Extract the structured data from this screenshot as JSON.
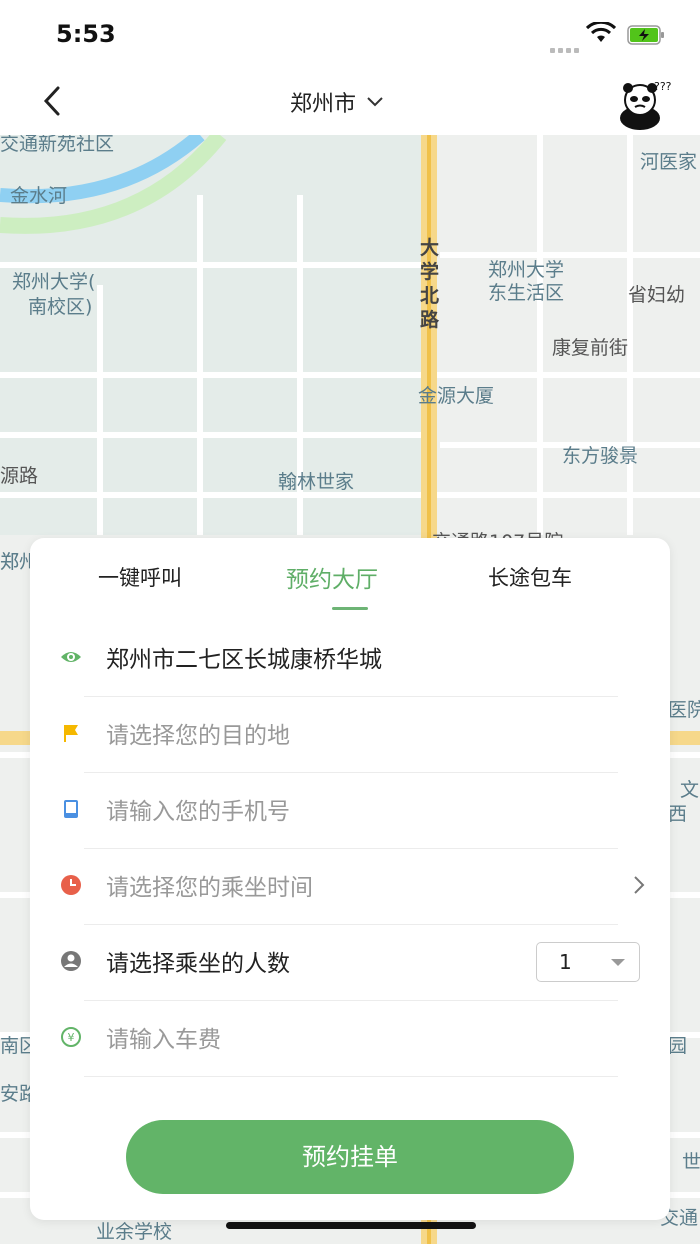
{
  "status_bar": {
    "time": "5:53"
  },
  "header": {
    "city": "郑州市"
  },
  "map": {
    "labels": [
      "交通新苑社区",
      "金水河",
      "郑州大学(",
      "南校区)",
      "大",
      "学",
      "北",
      "路",
      "郑州大学",
      "东生活区",
      "康复前街",
      "省妇幼",
      "金源大厦",
      "东方骏景",
      "翰林世家",
      "源路",
      "河医家",
      "郑州",
      "交通路107号院",
      "医院",
      "文",
      "西",
      "南区",
      "安路",
      "园",
      "业余学校",
      "世",
      "交通",
      "郑"
    ]
  },
  "tabs": [
    {
      "label": "一键呼叫",
      "active": false
    },
    {
      "label": "预约大厅",
      "active": true
    },
    {
      "label": "长途包车",
      "active": false
    }
  ],
  "form": {
    "origin": "郑州市二七区长城康桥华城",
    "destination_placeholder": "请选择您的目的地",
    "phone_placeholder": "请输入您的手机号",
    "time_placeholder": "请选择您的乘坐时间",
    "passengers_label": "请选择乘坐的人数",
    "passengers_value": "1",
    "fare_placeholder": "请输入车费",
    "submit_label": "预约挂单"
  },
  "colors": {
    "accent": "#62b468",
    "flag": "#f5b800",
    "phone_icon": "#4a90e2",
    "clock_icon": "#e8604a"
  }
}
